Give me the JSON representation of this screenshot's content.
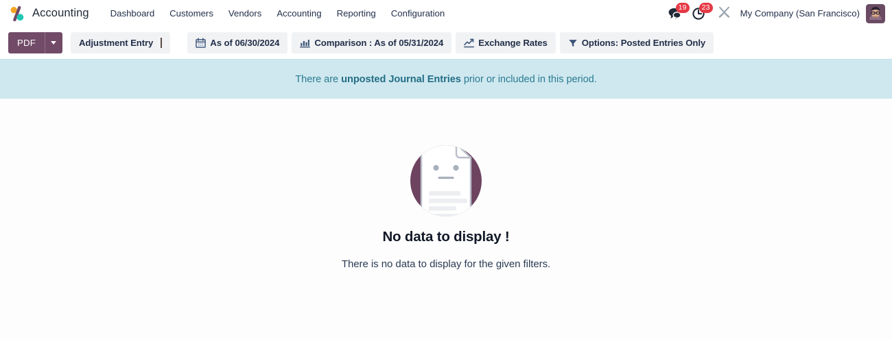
{
  "navbar": {
    "brand": "Accounting",
    "brand_logo_icon": "odoo-accounting-percent-logo",
    "menu": [
      {
        "label": "Dashboard"
      },
      {
        "label": "Customers"
      },
      {
        "label": "Vendors"
      },
      {
        "label": "Accounting"
      },
      {
        "label": "Reporting"
      },
      {
        "label": "Configuration"
      }
    ],
    "messages": {
      "icon": "chat-bubble-icon",
      "count": "19"
    },
    "activities": {
      "icon": "clock-icon",
      "count": "23"
    },
    "debug": {
      "icon": "tools-wrench-icon"
    },
    "company": "My Company (San Francisco)",
    "avatar_icon": "user-avatar"
  },
  "toolbar": {
    "pdf_label": "PDF",
    "pdf_caret_icon": "chevron-down-icon",
    "adjustment_entry_label": "Adjustment Entry",
    "date_filter": {
      "icon": "calendar-icon",
      "label": "As of 06/30/2024"
    },
    "comparison_filter": {
      "icon": "bar-chart-icon",
      "label": "Comparison : As of 05/31/2024"
    },
    "exchange_rates": {
      "icon": "line-chart-icon",
      "label": "Exchange Rates"
    },
    "options_filter": {
      "icon": "filter-funnel-icon",
      "label": "Options: Posted Entries Only"
    }
  },
  "banner": {
    "prefix": "There are ",
    "emphasis": "unposted Journal Entries",
    "suffix": " prior or included in this period."
  },
  "empty_state": {
    "illustration_icon": "no-data-document-face-illustration",
    "title": "No data to display !",
    "subtitle": "There is no data to display for the given filters."
  },
  "colors": {
    "brand_purple": "#714B67",
    "banner_bg": "#cfe8ef",
    "banner_text": "#2a7a92",
    "badge_red": "#e63946",
    "button_bg": "#f1f2f4",
    "text_dark": "#22304a"
  }
}
